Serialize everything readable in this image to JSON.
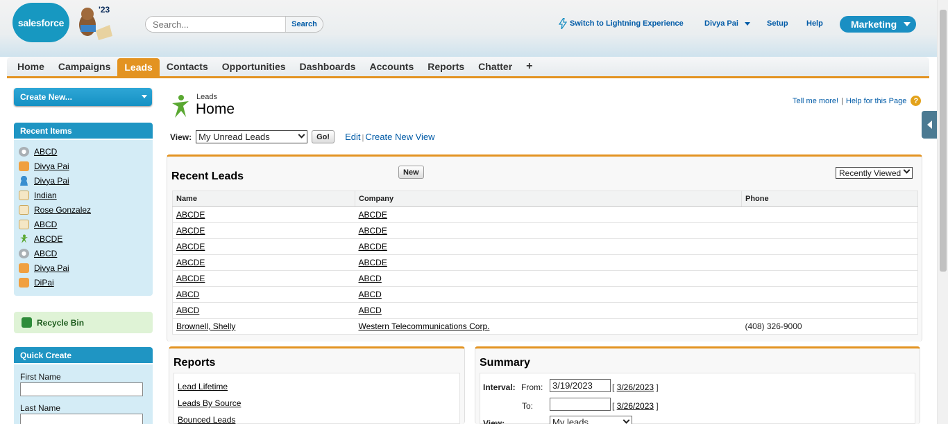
{
  "header": {
    "logo_text": "salesforce",
    "release_badge": "'23",
    "search_placeholder": "Search...",
    "search_button": "Search",
    "switch_lightning": "Switch to Lightning Experience",
    "user_name": "Divya Pai",
    "setup": "Setup",
    "help": "Help",
    "app_name": "Marketing"
  },
  "tabs": [
    "Home",
    "Campaigns",
    "Leads",
    "Contacts",
    "Opportunities",
    "Dashboards",
    "Accounts",
    "Reports",
    "Chatter",
    "+"
  ],
  "active_tab": "Leads",
  "sidebar": {
    "create_new": "Create New...",
    "recent_items_title": "Recent Items",
    "recent_items": [
      {
        "label": "ABCD",
        "icon": "campaign-icon"
      },
      {
        "label": "Divya Pai",
        "icon": "account-icon"
      },
      {
        "label": "Divya Pai",
        "icon": "contact-icon"
      },
      {
        "label": "Indian",
        "icon": "report-icon"
      },
      {
        "label": "Rose Gonzalez",
        "icon": "report-icon"
      },
      {
        "label": "ABCD",
        "icon": "report-icon"
      },
      {
        "label": "ABCDE",
        "icon": "lead-icon"
      },
      {
        "label": "ABCD",
        "icon": "campaign-icon"
      },
      {
        "label": "Divya Pai",
        "icon": "account-icon"
      },
      {
        "label": "DiPai",
        "icon": "account-icon"
      }
    ],
    "recycle_bin": "Recycle Bin",
    "quick_create_title": "Quick Create",
    "quick_create_fields": [
      "First Name",
      "Last Name"
    ]
  },
  "page": {
    "breadcrumb": "Leads",
    "title": "Home",
    "tell_me_more": "Tell me more!",
    "help_for_page": "Help for this Page",
    "help_icon": "?",
    "view_label": "View:",
    "view_selected": "My Unread Leads",
    "go_button": "Go!",
    "edit_link": "Edit",
    "create_view_link": "Create New View"
  },
  "recent_leads": {
    "title": "Recent Leads",
    "new_button": "New",
    "filter_selected": "Recently Viewed",
    "columns": [
      "Name",
      "Company",
      "Phone"
    ],
    "rows": [
      {
        "name": "ABCDE",
        "company": "ABCDE",
        "phone": ""
      },
      {
        "name": "ABCDE",
        "company": "ABCDE",
        "phone": ""
      },
      {
        "name": "ABCDE",
        "company": "ABCDE",
        "phone": ""
      },
      {
        "name": "ABCDE",
        "company": "ABCDE",
        "phone": ""
      },
      {
        "name": "ABCDE",
        "company": "ABCD",
        "phone": ""
      },
      {
        "name": "ABCD",
        "company": "ABCD",
        "phone": ""
      },
      {
        "name": "ABCD",
        "company": "ABCD",
        "phone": ""
      },
      {
        "name": "Brownell, Shelly",
        "company": "Western Telecommunications Corp.",
        "phone": "(408) 326-9000"
      }
    ]
  },
  "reports": {
    "title": "Reports",
    "links": [
      "Lead Lifetime",
      "Leads By Source",
      "Bounced Leads"
    ]
  },
  "summary": {
    "title": "Summary",
    "interval_label": "Interval:",
    "from_label": "From:",
    "from_value": "3/19/2023",
    "from_hint": "3/26/2023",
    "to_label": "To:",
    "to_value": "",
    "to_hint": "3/26/2023",
    "view_label": "View:",
    "view_selected": "My leads"
  },
  "colors": {
    "brand_blue": "#1798c1",
    "tab_accent": "#e39321",
    "sidebar_panel": "#d4ecf6",
    "link_blue": "#015ba7"
  }
}
